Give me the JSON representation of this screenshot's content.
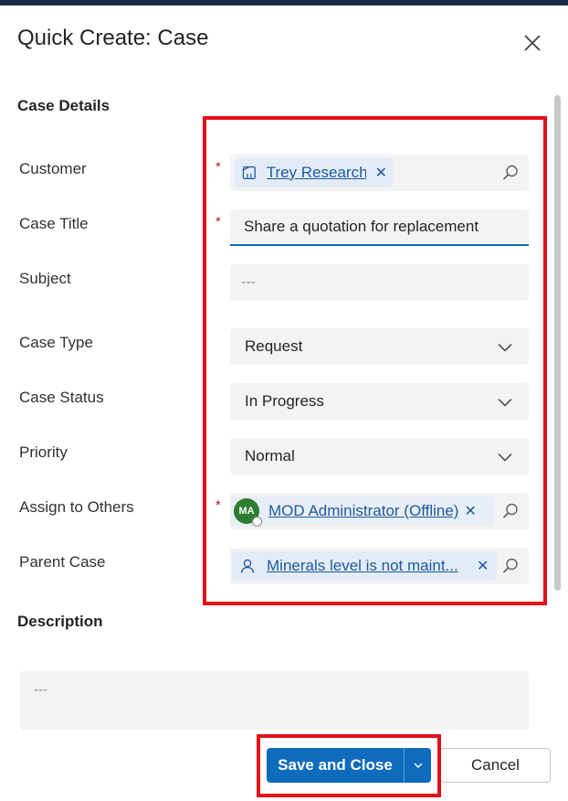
{
  "dialog": {
    "title": "Quick Create: Case",
    "close_icon": "close-icon"
  },
  "sections": {
    "case_details": "Case Details",
    "description": "Description"
  },
  "fields": {
    "customer": {
      "label": "Customer",
      "required": "*",
      "value": "Trey Research",
      "remove": "✕",
      "icon": "account-icon"
    },
    "case_title": {
      "label": "Case Title",
      "required": "*",
      "value": "Share a quotation for replacement"
    },
    "subject": {
      "label": "Subject",
      "value": "---"
    },
    "case_type": {
      "label": "Case Type",
      "value": "Request"
    },
    "case_status": {
      "label": "Case Status",
      "value": "In Progress"
    },
    "priority": {
      "label": "Priority",
      "value": "Normal"
    },
    "assign_to_others": {
      "label": "Assign to Others",
      "required": "*",
      "value": "MOD Administrator (Offline)",
      "avatar_initials": "MA",
      "remove": "✕"
    },
    "parent_case": {
      "label": "Parent Case",
      "value": "Minerals level is not maint...",
      "remove": "✕",
      "icon": "case-icon"
    },
    "description": {
      "value": "---"
    }
  },
  "footer": {
    "save_label": "Save and Close",
    "cancel_label": "Cancel"
  },
  "colors": {
    "accent": "#0f6cbd",
    "highlight": "#e3101a",
    "required": "#a4262c",
    "link": "#1d5a9c"
  }
}
